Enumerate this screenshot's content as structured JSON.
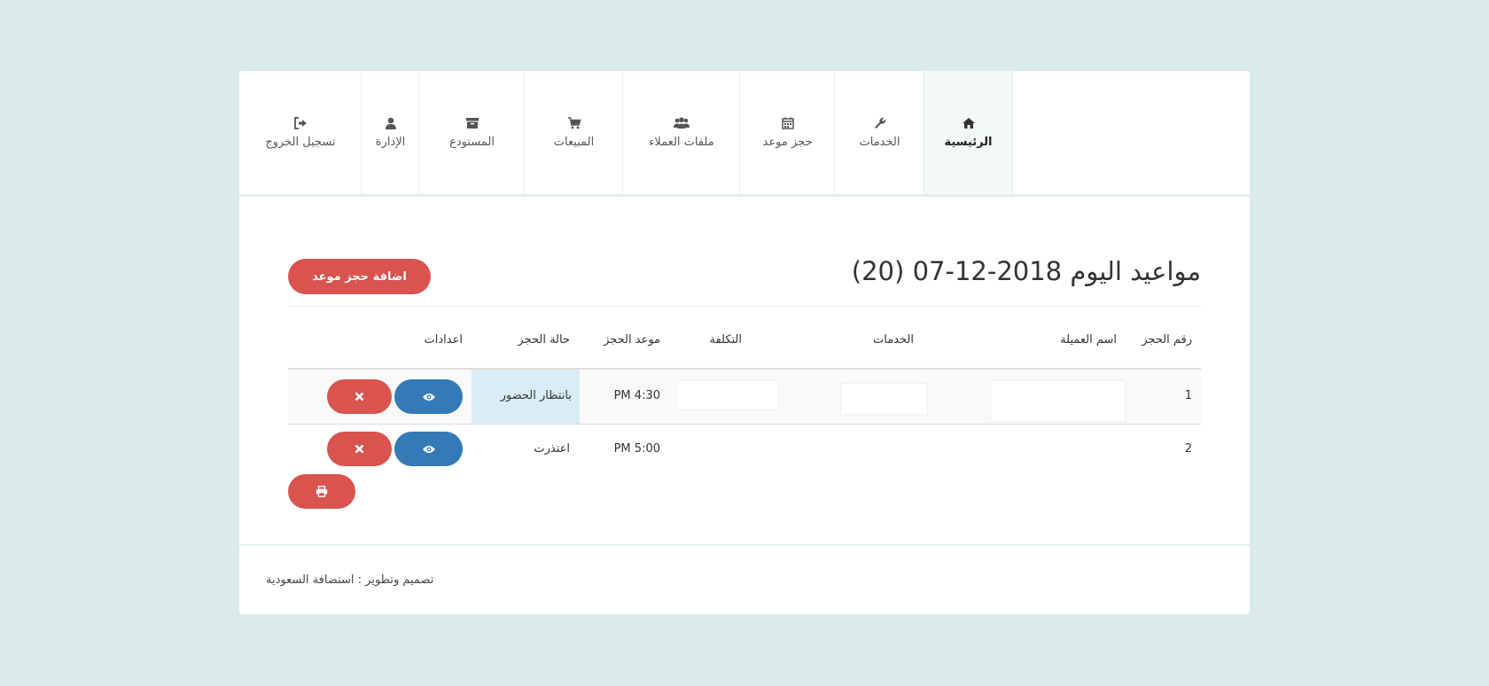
{
  "nav": {
    "items": [
      {
        "label": "الرئيسية",
        "icon": "home-icon"
      },
      {
        "label": "الخدمات",
        "icon": "wrench-icon"
      },
      {
        "label": "حجز موعد",
        "icon": "calendar-icon"
      },
      {
        "label": "ملفات العملاء",
        "icon": "users-icon"
      },
      {
        "label": "المبيعات",
        "icon": "cart-icon"
      },
      {
        "label": "المستودع",
        "icon": "archive-icon"
      },
      {
        "label": "الإدارة",
        "icon": "user-icon"
      },
      {
        "label": "تسجيل الخروج",
        "icon": "logout-icon"
      }
    ],
    "active_index": 0
  },
  "page": {
    "title": "مواعيد اليوم 2018-12-07 (20)",
    "add_button_label": "اضافة حجز موعد"
  },
  "table": {
    "headers": {
      "id": "رقم الحجز",
      "client": "اسم العميلة",
      "services": "الخدمات",
      "cost": "التكلفة",
      "time": "موعد الحجز",
      "status": "حالة الحجز",
      "settings": "اعدادات"
    },
    "rows": [
      {
        "id": "1",
        "client": "",
        "services": "",
        "cost": "",
        "time": "4:30 PM",
        "status": "بانتظار الحضور"
      },
      {
        "id": "2",
        "client": "",
        "services": "",
        "cost": "",
        "time": "5:00 PM",
        "status": "اعتذرت"
      }
    ]
  },
  "footer": {
    "text": "تصميم وتطوير : استضافة السعودية"
  },
  "colors": {
    "background": "#d9ebeb",
    "danger": "#d9534f",
    "primary": "#337ab7",
    "info_cell": "#d9edf7"
  }
}
